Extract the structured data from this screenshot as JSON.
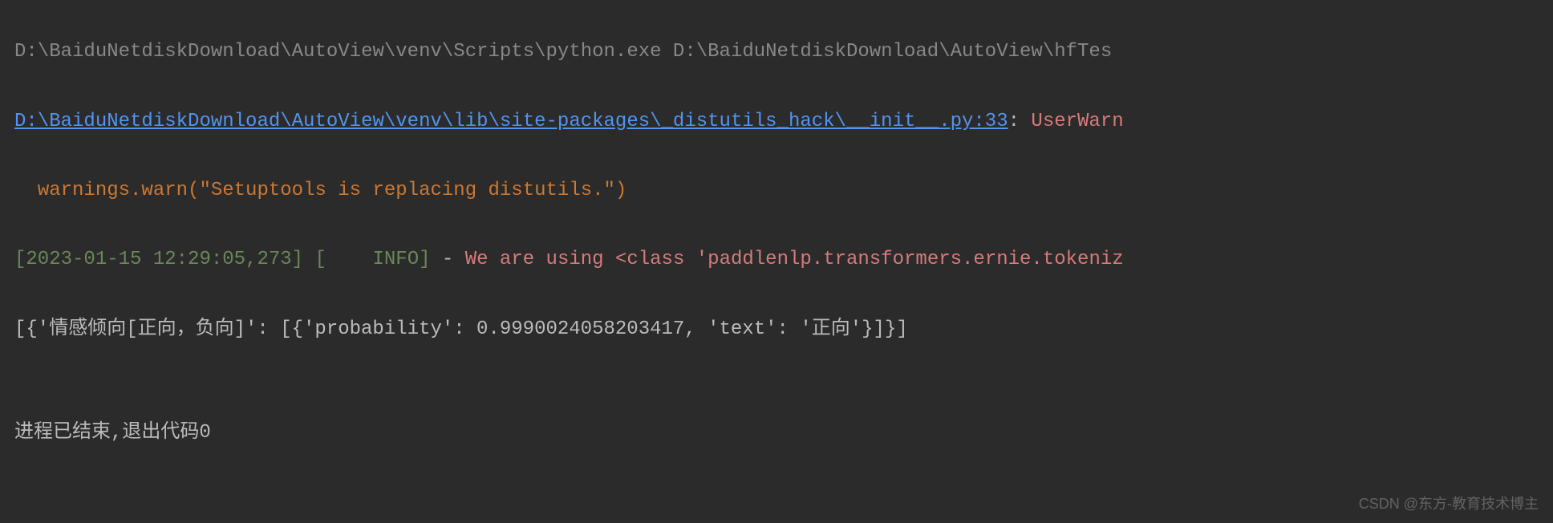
{
  "terminal": {
    "lines": {
      "partial_top": "D:\\BaiduNetdiskDownload\\AutoView\\venv\\Scripts\\python.exe D:\\BaiduNetdiskDownload\\AutoView\\hfTes",
      "link_path": "D:\\BaiduNetdiskDownload\\AutoView\\venv\\lib\\site-packages\\_distutils_hack\\__init__.py:33",
      "colon_sep": ": ",
      "warning_type": "UserWarn",
      "warning_indent": "  ",
      "warning_msg": "warnings.warn(\"Setuptools is replacing distutils.\")",
      "timestamp": "[2023-01-15 12:29:05,273] ",
      "info_label": "[    INFO]",
      "dash_sep": " - ",
      "log_message": "We are using <class 'paddlenlp.transformers.ernie.tokeniz",
      "result_output": "[{'情感倾向[正向，负向]': [{'probability': 0.9990024058203417, 'text': '正向'}]}]",
      "blank": "",
      "exit_message": "进程已结束,退出代码0"
    }
  },
  "watermark": "CSDN @东方-教育技术博主"
}
